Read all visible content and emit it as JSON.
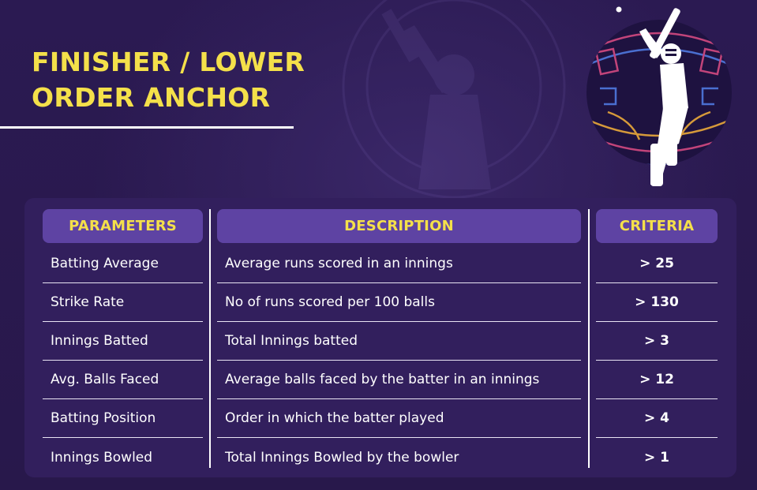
{
  "title_line1": "FINISHER / LOWER",
  "title_line2": "ORDER ANCHOR",
  "colors": {
    "accent_yellow": "#f4e04a",
    "header_purple": "#5e43a3",
    "card_bg": "#321f5d",
    "page_bg": "#2a1a4e"
  },
  "table": {
    "headers": {
      "parameters": "PARAMETERS",
      "description": "DESCRIPTION",
      "criteria": "CRITERIA"
    },
    "rows": [
      {
        "parameter": "Batting Average",
        "description": "Average runs scored in an innings",
        "criteria": "> 25"
      },
      {
        "parameter": "Strike Rate",
        "description": "No of runs scored per 100 balls",
        "criteria": "> 130"
      },
      {
        "parameter": "Innings Batted",
        "description": "Total Innings batted",
        "criteria": "> 3"
      },
      {
        "parameter": "Avg. Balls Faced",
        "description": "Average balls faced by the batter in an innings",
        "criteria": "> 12"
      },
      {
        "parameter": "Batting Position",
        "description": "Order in which the batter played",
        "criteria": "> 4"
      },
      {
        "parameter": "Innings Bowled",
        "description": "Total Innings Bowled by the bowler",
        "criteria": "> 1"
      }
    ]
  },
  "icons": {
    "emblem": "cricket-batter-emblem-icon",
    "background": "batter-silhouette-icon"
  }
}
